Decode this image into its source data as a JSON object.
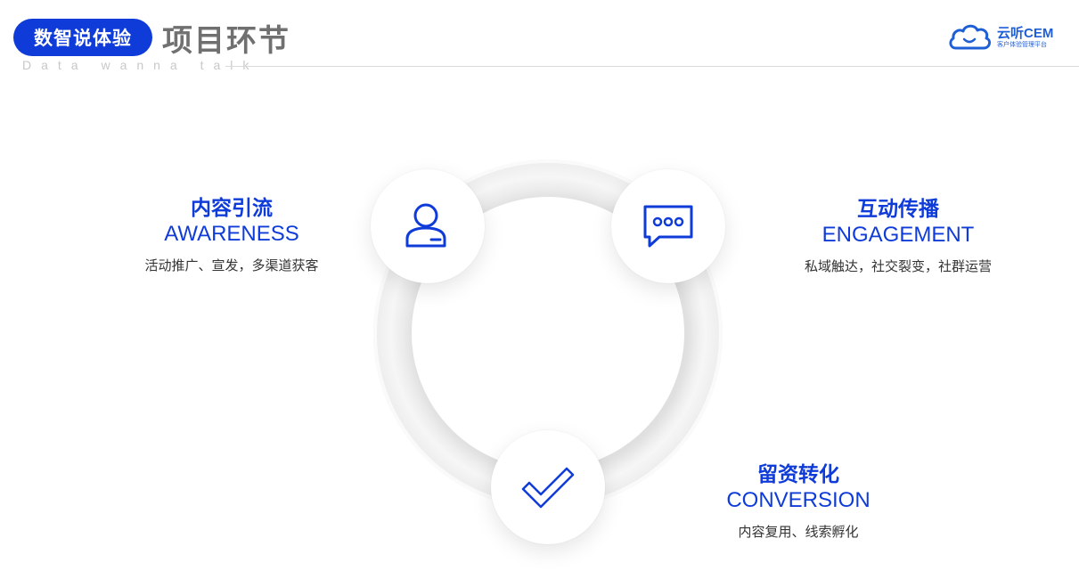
{
  "header": {
    "brand_label": "数智说体验",
    "page_title": "项目环节",
    "tagline": "Data wanna talk",
    "logo": {
      "name": "云听CEM",
      "subtitle": "客户体验管理平台",
      "icon": "cloud-icon",
      "color": "#1f5fd6"
    }
  },
  "accent_color": "#0f3cd9",
  "stages": [
    {
      "title": "内容引流",
      "english": "AWARENESS",
      "description": "活动推广、宣发，多渠道获客",
      "icon": "person-icon"
    },
    {
      "title": "互动传播",
      "english": "ENGAGEMENT",
      "description": "私域触达，社交裂变，社群运营",
      "icon": "chat-bubble-icon"
    },
    {
      "title": "留资转化",
      "english": "CONVERSION",
      "description": "内容复用、线索孵化",
      "icon": "checkmark-icon"
    }
  ]
}
